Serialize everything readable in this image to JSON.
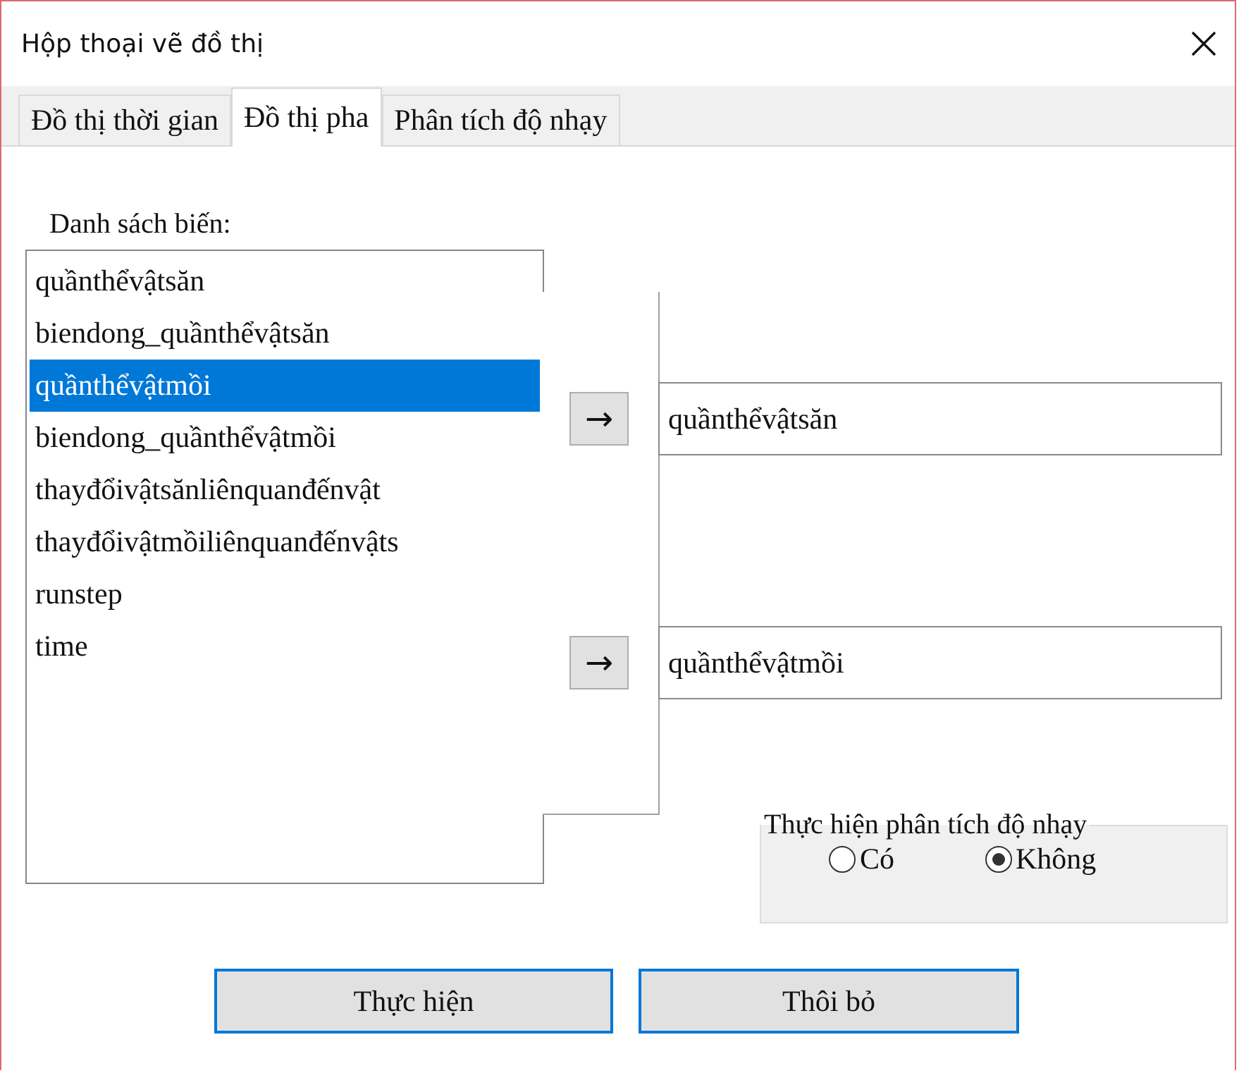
{
  "window": {
    "title": "Hộp thoại vẽ đồ thị"
  },
  "tabs": [
    {
      "label": "Đồ thị thời gian",
      "selected": false
    },
    {
      "label": "Đồ thị pha",
      "selected": true
    },
    {
      "label": "Phân tích độ nhạy",
      "selected": false
    }
  ],
  "variable_list": {
    "label": "Danh sách biến:",
    "items": [
      {
        "text": "quầnthểvậtsăn",
        "selected": false
      },
      {
        "text": "biendong_quầnthểvậtsăn",
        "selected": false
      },
      {
        "text": "quầnthểvậtmồi",
        "selected": true
      },
      {
        "text": "biendong_quầnthểvậtmồi",
        "selected": false
      },
      {
        "text": "thayđổivậtsănliênquanđếnvật",
        "selected": false
      },
      {
        "text": "thayđổivậtmồiliênquanđếnvậts",
        "selected": false
      },
      {
        "text": "runstep",
        "selected": false
      },
      {
        "text": "time",
        "selected": false
      }
    ]
  },
  "axis_selectors": [
    {
      "arrow": "→",
      "value": "quầnthểvậtsăn"
    },
    {
      "arrow": "→",
      "value": "quầnthểvậtmồi"
    }
  ],
  "sensitivity": {
    "legend": "Thực hiện phân tích độ nhạy",
    "options": [
      {
        "label": "Có",
        "selected": false
      },
      {
        "label": "Không",
        "selected": true
      }
    ]
  },
  "buttons": [
    "Thực hiện",
    "Thôi bỏ"
  ]
}
